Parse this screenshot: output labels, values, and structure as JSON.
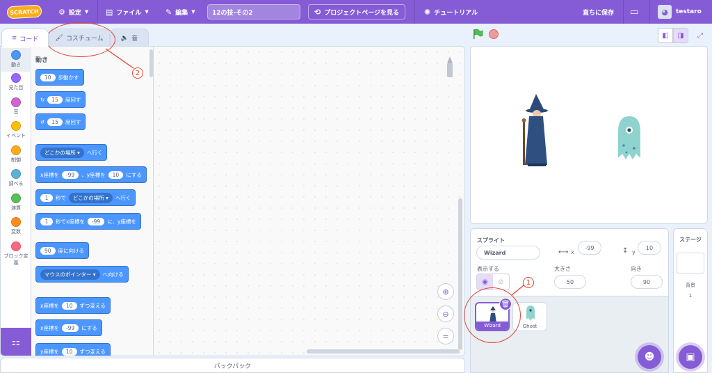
{
  "menubar": {
    "logo": "SCRATCH",
    "settings": "設定",
    "file": "ファイル",
    "edit": "編集",
    "project_title": "12の技-その2",
    "project_page": "プロジェクトページを見る",
    "tutorial": "チュートリアル",
    "save_now": "直ちに保存",
    "username": "testaro"
  },
  "tabs": {
    "code": "コード",
    "costumes": "コスチューム",
    "sounds": "音"
  },
  "categories": [
    {
      "label": "動き",
      "color": "#4c97ff"
    },
    {
      "label": "見た目",
      "color": "#9966ff"
    },
    {
      "label": "音",
      "color": "#cf63cf"
    },
    {
      "label": "イベント",
      "color": "#ffbf00"
    },
    {
      "label": "制御",
      "color": "#ffab19"
    },
    {
      "label": "調べる",
      "color": "#5cb1d6"
    },
    {
      "label": "演算",
      "color": "#59c059"
    },
    {
      "label": "変数",
      "color": "#ff8c1a"
    },
    {
      "label": "ブロック定義",
      "color": "#ff6680"
    }
  ],
  "palette": {
    "heading": "動き",
    "b1": {
      "num": "10",
      "text": "歩動かす"
    },
    "b2": {
      "num": "15",
      "text": "度回す"
    },
    "b3": {
      "num": "15",
      "text": "度回す"
    },
    "b4": {
      "drop": "どこかの場所",
      "text": "へ行く"
    },
    "b5": {
      "t1": "x座標を",
      "x": "-99",
      "t2": "、y座標を",
      "y": "10",
      "t3": "にする"
    },
    "b6": {
      "num": "1",
      "t1": "秒で",
      "drop": "どこかの場所",
      "t2": "へ行く"
    },
    "b7": {
      "num": "1",
      "t1": "秒でx座標を",
      "x": "-99",
      "t2": "に、y座標を"
    },
    "b8": {
      "num": "90",
      "text": "度に向ける"
    },
    "b9": {
      "drop": "マウスのポインター",
      "text": "へ向ける"
    },
    "b10": {
      "t1": "x座標を",
      "num": "10",
      "t2": "ずつ変える"
    },
    "b11": {
      "t1": "x座標を",
      "num": "-99",
      "t2": "にする"
    },
    "b12": {
      "t1": "y座標を",
      "num": "10",
      "t2": "ずつ変える"
    }
  },
  "backpack": "バックパック",
  "sprite_info": {
    "sprite_label": "スプライト",
    "sprite_name": "Wizard",
    "x_label": "x",
    "x_value": "-99",
    "y_label": "y",
    "y_value": "10",
    "show_label": "表示する",
    "size_label": "大きさ",
    "size_value": "50",
    "direction_label": "向き",
    "direction_value": "90"
  },
  "sprites": [
    {
      "name": "Wizard",
      "selected": true
    },
    {
      "name": "Ghost",
      "selected": false
    }
  ],
  "stage_pane": {
    "title": "ステージ",
    "backdrops_label": "背景",
    "backdrops_count": "1"
  },
  "annotations": {
    "one": "1",
    "two": "2",
    "color": "#e0442f"
  },
  "colors": {
    "accent": "#855cd6",
    "motion": "#4c97ff"
  }
}
